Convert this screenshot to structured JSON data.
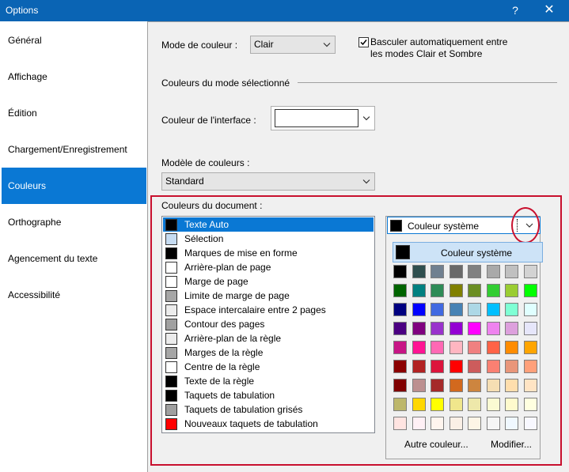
{
  "window": {
    "title": "Options",
    "help_glyph": "?",
    "close_glyph": "✕"
  },
  "sidebar": {
    "items": [
      {
        "label": "Général"
      },
      {
        "label": "Affichage"
      },
      {
        "label": "Édition"
      },
      {
        "label": "Chargement/Enregistrement"
      },
      {
        "label": "Couleurs"
      },
      {
        "label": "Orthographe"
      },
      {
        "label": "Agencement du texte"
      },
      {
        "label": "Accessibilité"
      }
    ],
    "selected": "Couleurs"
  },
  "panel": {
    "mode_label": "Mode de couleur :",
    "mode_value": "Clair",
    "auto_switch_label_line1": "Basculer automatiquement entre",
    "auto_switch_label_line2": "les modes Clair et Sombre",
    "auto_switch_checked": true,
    "section_title": "Couleurs du mode sélectionné",
    "interface_color_label": "Couleur de l'interface :",
    "interface_color_value": "",
    "model_label": "Modèle de couleurs :",
    "model_value": "Standard",
    "doc_colors_label": "Couleurs du document :",
    "doc_colors": [
      {
        "label": "Texte Auto",
        "color": "#000000",
        "selected": true
      },
      {
        "label": "Sélection",
        "color": "#c6dcf2"
      },
      {
        "label": "Marques de mise en forme",
        "color": "#000000"
      },
      {
        "label": "Arrière-plan de page",
        "color": "#ffffff"
      },
      {
        "label": "Marge de page",
        "color": "#ffffff"
      },
      {
        "label": "Limite de marge de page",
        "color": "#a6a6a6"
      },
      {
        "label": "Espace intercalaire entre 2 pages",
        "color": "#ececec"
      },
      {
        "label": "Contour des pages",
        "color": "#a0a0a0"
      },
      {
        "label": "Arrière-plan de la règle",
        "color": "#ececec"
      },
      {
        "label": "Marges de la règle",
        "color": "#a6a6a6"
      },
      {
        "label": "Centre de la règle",
        "color": "#ffffff"
      },
      {
        "label": "Texte de la règle",
        "color": "#000000"
      },
      {
        "label": "Taquets de tabulation",
        "color": "#000000"
      },
      {
        "label": "Taquets de tabulation grisés",
        "color": "#a0a0a0"
      },
      {
        "label": "Nouveaux taquets de tabulation",
        "color": "#ff0000"
      }
    ]
  },
  "picker": {
    "current_label": "Couleur système",
    "current_color": "#000000",
    "system_button_label": "Couleur système",
    "other_color_label": "Autre couleur...",
    "modify_label": "Modifier...",
    "grid": [
      [
        "#000000",
        "#2f4f4f",
        "#708090",
        "#696969",
        "#808080",
        "#a9a9a9",
        "#c0c0c0",
        "#d3d3d3"
      ],
      [
        "#006400",
        "#008080",
        "#2e8b57",
        "#808000",
        "#6b8e23",
        "#32cd32",
        "#9acd32",
        "#00ff00"
      ],
      [
        "#000080",
        "#0000ff",
        "#4169e1",
        "#4682b4",
        "#add8e6",
        "#00bfff",
        "#7fffd4",
        "#e0ffff"
      ],
      [
        "#4b0082",
        "#800080",
        "#9932cc",
        "#9400d3",
        "#ff00ff",
        "#ee82ee",
        "#dda0dd",
        "#e6e6fa"
      ],
      [
        "#c71585",
        "#ff1493",
        "#ff69b4",
        "#ffb6c1",
        "#f08080",
        "#ff6347",
        "#ff8c00",
        "#ffa500"
      ],
      [
        "#8b0000",
        "#b22222",
        "#dc143c",
        "#ff0000",
        "#cd5c5c",
        "#fa8072",
        "#e9967a",
        "#ffa07a"
      ],
      [
        "#800000",
        "#bc8f8f",
        "#a52a2a",
        "#d2691e",
        "#cd853f",
        "#f5deb3",
        "#ffdead",
        "#ffe4c4"
      ],
      [
        "#bdb76b",
        "#ffd700",
        "#ffff00",
        "#f0e68c",
        "#eee8aa",
        "#fafad2",
        "#fffacd",
        "#ffffe0"
      ],
      [
        "#ffe4e1",
        "#fff0f5",
        "#fff5ee",
        "#faf0e6",
        "#fdf5e6",
        "#f5f5f5",
        "#f0f8ff",
        "#f8f8ff"
      ]
    ]
  }
}
